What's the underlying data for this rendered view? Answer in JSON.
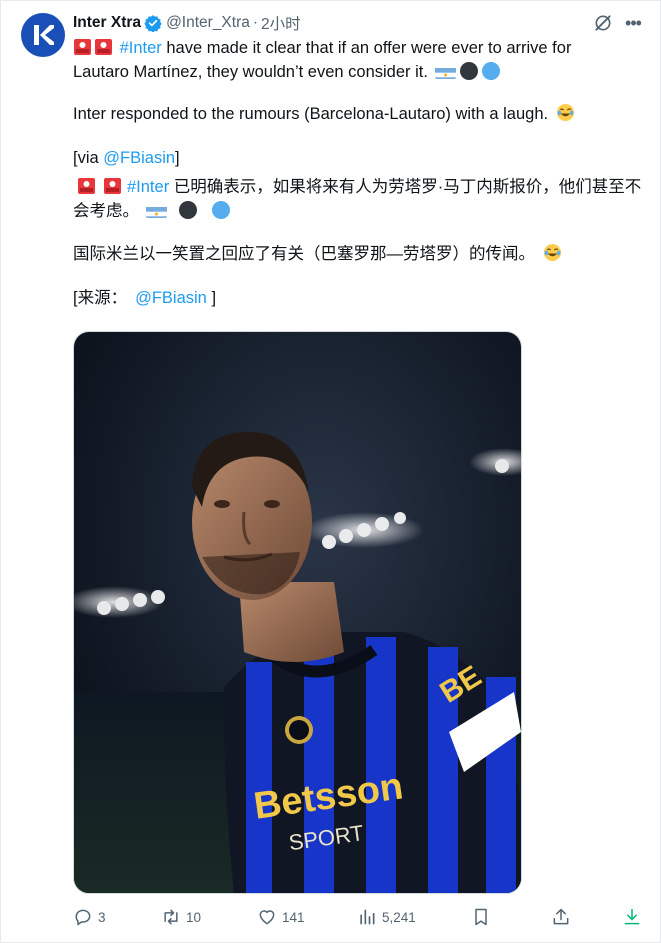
{
  "author": {
    "name": "Inter Xtra",
    "handle": "@Inter_Xtra",
    "separator": "·",
    "time": "2小时",
    "avatar_letter": "K",
    "avatar_color": "#1b4fb8",
    "verified_color": "#1d9bf0"
  },
  "tweet": {
    "en_line1_hashtag": "#Inter",
    "en_line1_rest": " have made it clear that if an offer were ever to arrive for",
    "en_line2": "Lautaro Martínez, they wouldn’t even consider it.",
    "en_para2": "Inter responded to the rumours (Barcelona-Lautaro) with a laugh.",
    "en_via_prefix": "[via ",
    "en_via_mention": "@FBiasin",
    "en_via_suffix": "]",
    "zh_line1_hashtag": "#Inter",
    "zh_line1_rest": " 已明确表示，如果将来有人为劳塔罗·马丁内斯报价，他们甚至不",
    "zh_line2": "会考虑。",
    "zh_para2": "国际米兰以一笑置之回应了有关（巴塞罗那—劳塔罗）的传闻。",
    "zh_src_prefix": "[来源：",
    "zh_src_mention": "@FBiasin",
    "zh_src_suffix": " ]"
  },
  "actions": {
    "replies": "3",
    "reposts": "10",
    "likes": "141",
    "views": "5,241"
  },
  "colors": {
    "link": "#1d9bf0",
    "muted": "#536471",
    "jersey_blue": "#1736c9"
  },
  "icons": [
    "verified-icon",
    "grok-icon",
    "more-icon",
    "reply-icon",
    "repost-icon",
    "like-icon",
    "views-icon",
    "bookmark-icon",
    "share-icon",
    "download-icon",
    "siren-emoji",
    "argentina-flag-emoji",
    "black-circle-emoji",
    "blue-circle-emoji",
    "laughing-emoji"
  ]
}
